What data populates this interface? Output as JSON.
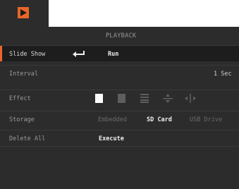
{
  "tab": {
    "icon": "play-icon",
    "accent": "#e8662a"
  },
  "header": {
    "title": "PLAYBACK"
  },
  "rows": {
    "slideshow": {
      "label": "Slide Show",
      "enter_icon": "enter-arrow-icon",
      "action": "Run"
    },
    "interval": {
      "label": "Interval",
      "value": "1 Sec"
    },
    "effect": {
      "label": "Effect",
      "options": [
        "white-square-icon",
        "gray-square-icon",
        "horizontal-lines-icon",
        "vertical-split-icon",
        "horizontal-split-icon"
      ],
      "selected_index": 0
    },
    "storage": {
      "label": "Storage",
      "options": [
        "Embedded",
        "SD Card",
        "USB Drive"
      ],
      "selected": "SD Card"
    },
    "delete": {
      "label": "Delete All",
      "action": "Execute"
    }
  },
  "colors": {
    "background": "#2c2c2c",
    "selected_row": "#1d1d1d",
    "accent": "#e8662a",
    "text": "#9b9b9b",
    "value": "#efefef",
    "disabled": "#6a6a6a"
  }
}
